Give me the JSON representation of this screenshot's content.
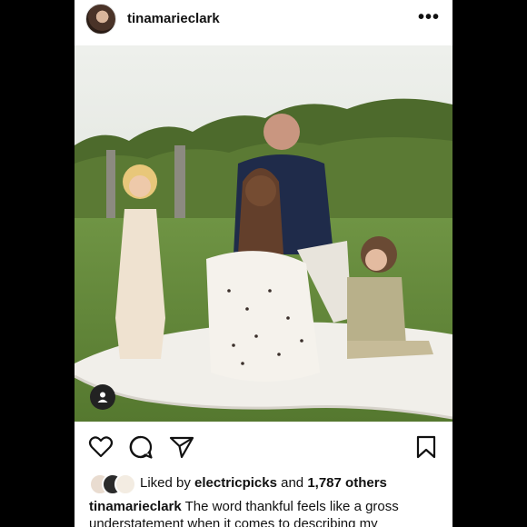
{
  "post": {
    "username": "tinamarieclark",
    "more_label": "•••"
  },
  "likes": {
    "prefix": "Liked by",
    "liker": "electricpicks",
    "and": "and",
    "others": "1,787 others"
  },
  "caption": {
    "username": "tinamarieclark",
    "text": "The word thankful feels like a gross understatement when it comes to describing my"
  },
  "icons": {
    "more": "more-dots-icon",
    "like": "heart-icon",
    "comment": "comment-bubble-icon",
    "share": "send-icon",
    "save": "bookmark-icon",
    "tagged": "user-tag-icon"
  }
}
